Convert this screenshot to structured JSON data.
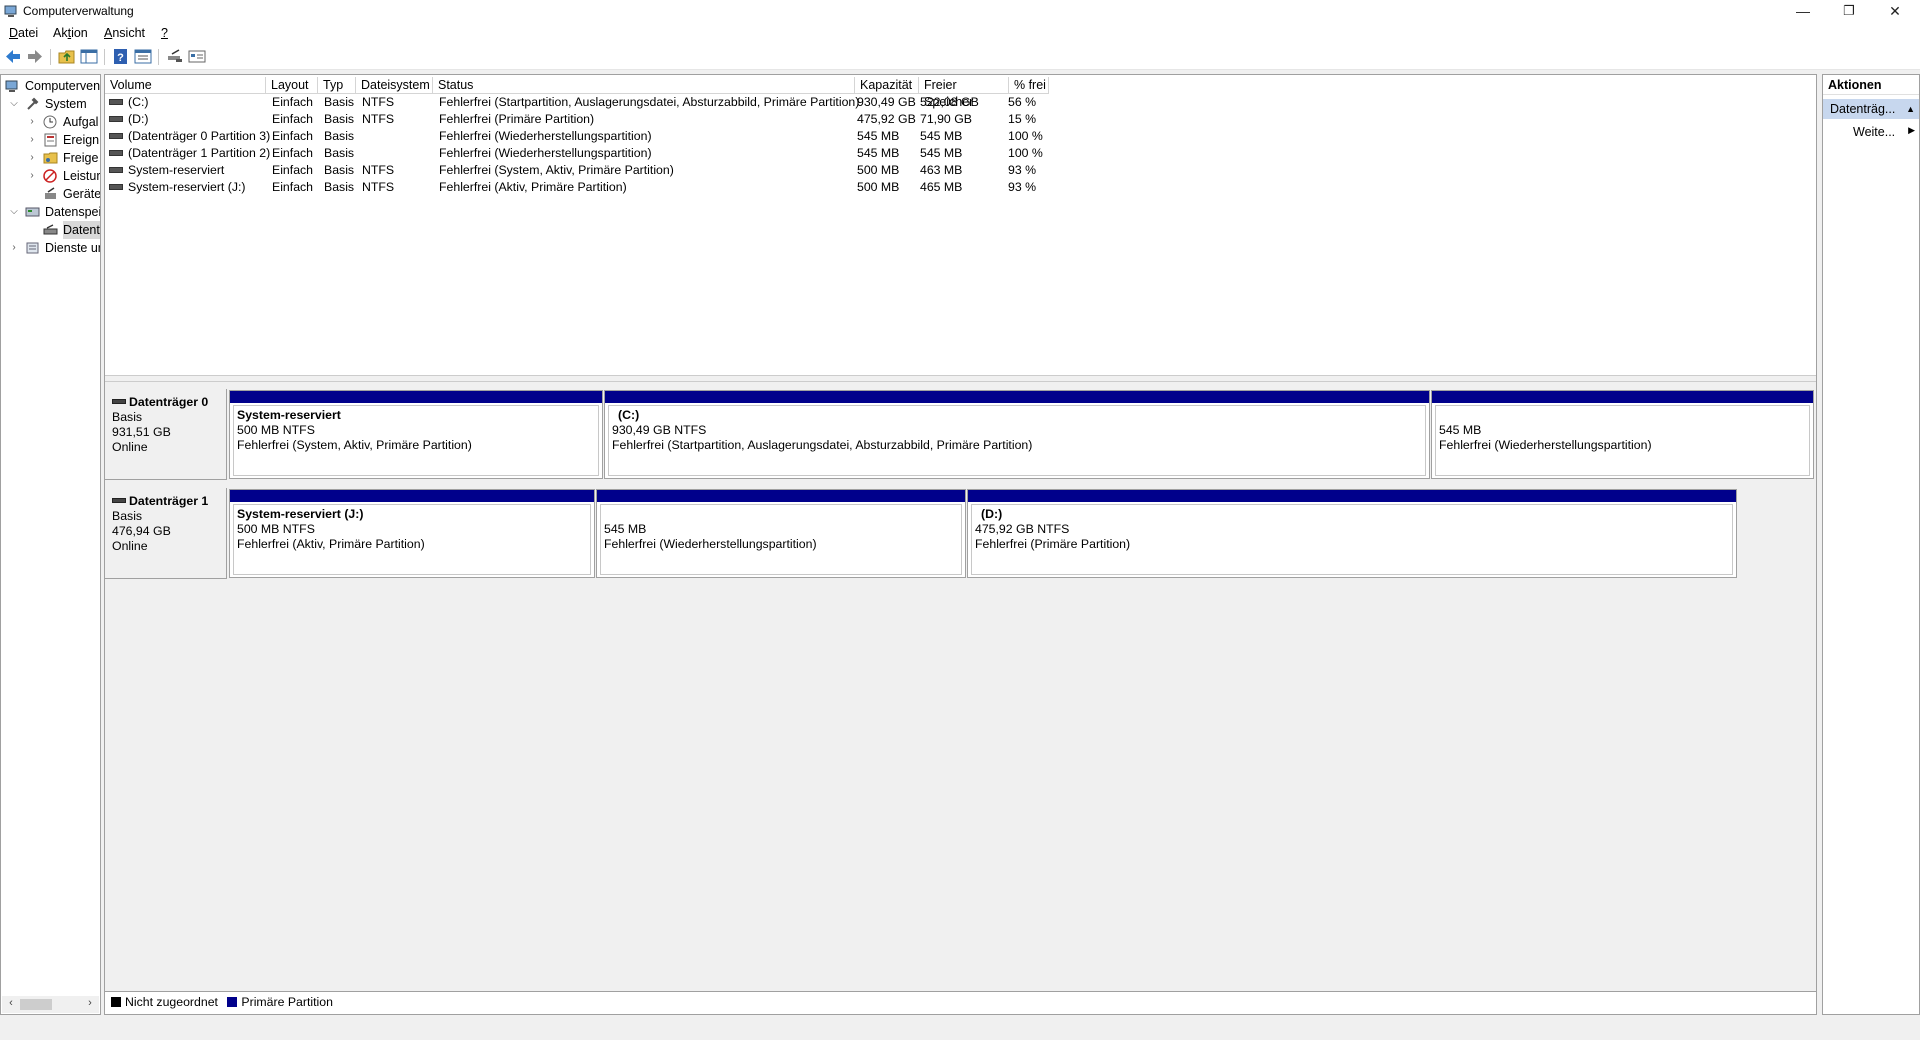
{
  "window": {
    "title": "Computerverwaltung",
    "min_glyph": "—",
    "max_glyph": "❐",
    "close_glyph": "✕"
  },
  "menu": [
    {
      "prefix": "",
      "accel": "D",
      "rest": "atei"
    },
    {
      "prefix": "Ak",
      "accel": "t",
      "rest": "ion"
    },
    {
      "prefix": "",
      "accel": "A",
      "rest": "nsicht"
    },
    {
      "prefix": "",
      "accel": "?",
      "rest": ""
    }
  ],
  "toolbar": [
    "back-icon",
    "forward-icon",
    "up-folder-icon",
    "show-hide-tree-icon",
    "help-icon",
    "properties-icon",
    "connect-icon",
    "view-icon"
  ],
  "tree": {
    "items": [
      {
        "label": "Computerverwaltung (Lokal)",
        "icon": "computer-management-icon"
      },
      {
        "label": "System",
        "icon": "system-tools-icon",
        "expanded": true
      },
      {
        "label": "Aufgabenplanung",
        "icon": "task-scheduler-icon"
      },
      {
        "label": "Ereignisanzeige",
        "icon": "event-viewer-icon"
      },
      {
        "label": "Freigegebene Ordner",
        "icon": "shared-folders-icon"
      },
      {
        "label": "Leistung",
        "icon": "performance-icon"
      },
      {
        "label": "Geräte-Manager",
        "icon": "device-manager-icon"
      },
      {
        "label": "Datenspeicher",
        "icon": "storage-icon",
        "expanded": true
      },
      {
        "label": "Datenträgerverwaltung",
        "icon": "disk-management-icon",
        "selected": true
      },
      {
        "label": "Dienste und Anwendungen",
        "icon": "services-icon"
      }
    ],
    "visible": [
      "Computerven",
      "System",
      "Aufgal",
      "Ereign",
      "Freige",
      "Leistur",
      "Geräte",
      "Datenspei",
      "Datent",
      "Dienste ur"
    ]
  },
  "volume_table": {
    "columns": [
      "Volume",
      "Layout",
      "Typ",
      "Dateisystem",
      "Status",
      "Kapazität",
      "Freier Speicher",
      "% frei"
    ],
    "rows": [
      [
        "(C:)",
        "Einfach",
        "Basis",
        "NTFS",
        "Fehlerfrei (Startpartition, Auslagerungsdatei, Absturzabbild, Primäre Partition)",
        "930,49 GB",
        "522,08 GB",
        "56 %"
      ],
      [
        "(D:)",
        "Einfach",
        "Basis",
        "NTFS",
        "Fehlerfrei (Primäre Partition)",
        "475,92 GB",
        "71,90 GB",
        "15 %"
      ],
      [
        "(Datenträger 0 Partition 3)",
        "Einfach",
        "Basis",
        "",
        "Fehlerfrei (Wiederherstellungspartition)",
        "545 MB",
        "545 MB",
        "100 %"
      ],
      [
        "(Datenträger 1 Partition 2)",
        "Einfach",
        "Basis",
        "",
        "Fehlerfrei (Wiederherstellungspartition)",
        "545 MB",
        "545 MB",
        "100 %"
      ],
      [
        "System-reserviert",
        "Einfach",
        "Basis",
        "NTFS",
        "Fehlerfrei (System, Aktiv, Primäre Partition)",
        "500 MB",
        "463 MB",
        "93 %"
      ],
      [
        "System-reserviert (J:)",
        "Einfach",
        "Basis",
        "NTFS",
        "Fehlerfrei (Aktiv, Primäre Partition)",
        "500 MB",
        "465 MB",
        "93 %"
      ]
    ]
  },
  "disks": [
    {
      "name": "Datenträger 0",
      "type": "Basis",
      "size": "931,51 GB",
      "status": "Online",
      "partitions": [
        {
          "name": "System-reserviert",
          "size": "500 MB NTFS",
          "status": "Fehlerfrei (System, Aktiv, Primäre Partition)"
        },
        {
          "name": "(C:)",
          "size": "930,49 GB NTFS",
          "status": "Fehlerfrei (Startpartition, Auslagerungsdatei, Absturzabbild, Primäre Partition)"
        },
        {
          "name": "",
          "size": "545 MB",
          "status": "Fehlerfrei (Wiederherstellungspartition)"
        }
      ]
    },
    {
      "name": "Datenträger 1",
      "type": "Basis",
      "size": "476,94 GB",
      "status": "Online",
      "partitions": [
        {
          "name": "System-reserviert  (J:)",
          "size": "500 MB NTFS",
          "status": "Fehlerfrei (Aktiv, Primäre Partition)"
        },
        {
          "name": "",
          "size": "545 MB",
          "status": "Fehlerfrei (Wiederherstellungspartition)"
        },
        {
          "name": "(D:)",
          "size": "475,92 GB NTFS",
          "status": "Fehlerfrei (Primäre Partition)"
        }
      ]
    }
  ],
  "legend": [
    {
      "label": "Nicht zugeordnet",
      "color": "#000000"
    },
    {
      "label": "Primäre Partition",
      "color": "#00008b"
    }
  ],
  "actions": {
    "header": "Aktionen",
    "section": "Datenträg...",
    "item": "Weite..."
  },
  "colors": {
    "primary_partition": "#00008b",
    "selection": "#c7d7ee"
  }
}
